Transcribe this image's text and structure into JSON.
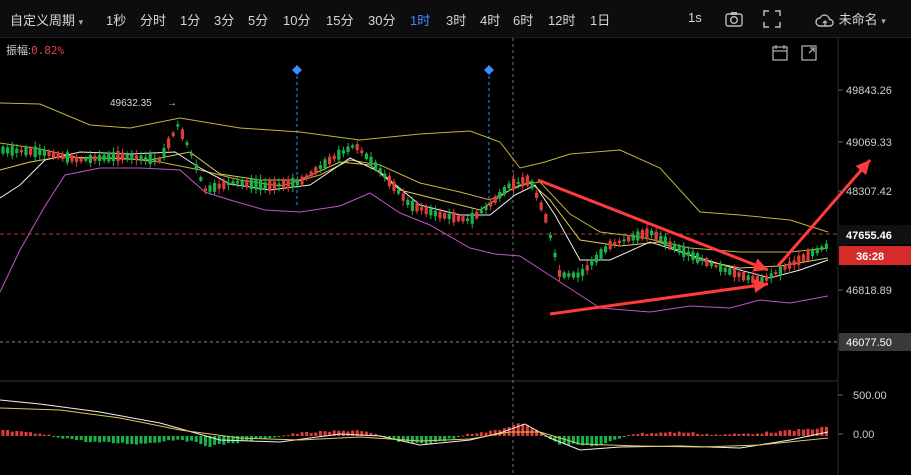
{
  "toolbar": {
    "custom_period": "自定义周期",
    "intervals": [
      "1秒",
      "分时",
      "1分",
      "3分",
      "5分",
      "10分",
      "15分",
      "30分",
      "1时",
      "3时",
      "4时",
      "6时",
      "12时",
      "1日"
    ],
    "active_interval": "1时",
    "right_label": "1s",
    "cloud_label": "未命名"
  },
  "amplitude": {
    "label": "振幅:",
    "value": "0.82%"
  },
  "price_axis": {
    "ticks": [
      "49843.26",
      "49069.33",
      "48307.42",
      "46818.89"
    ],
    "current_price": "47655.46",
    "countdown": "36:28",
    "dashed_level": "46077.50"
  },
  "annotations": {
    "high_label": "49632.35"
  },
  "macd_axis": {
    "ticks": [
      "500.00",
      "0.00"
    ]
  },
  "colors": {
    "up": "#e03c3c",
    "down": "#19b34a",
    "accent": "#3d8bff",
    "arrow": "#ff3b3b",
    "bb": "#c8b23a",
    "ma1": "#f0f0f0",
    "ma2": "#e0c85a",
    "lower": "#c055c8"
  }
}
